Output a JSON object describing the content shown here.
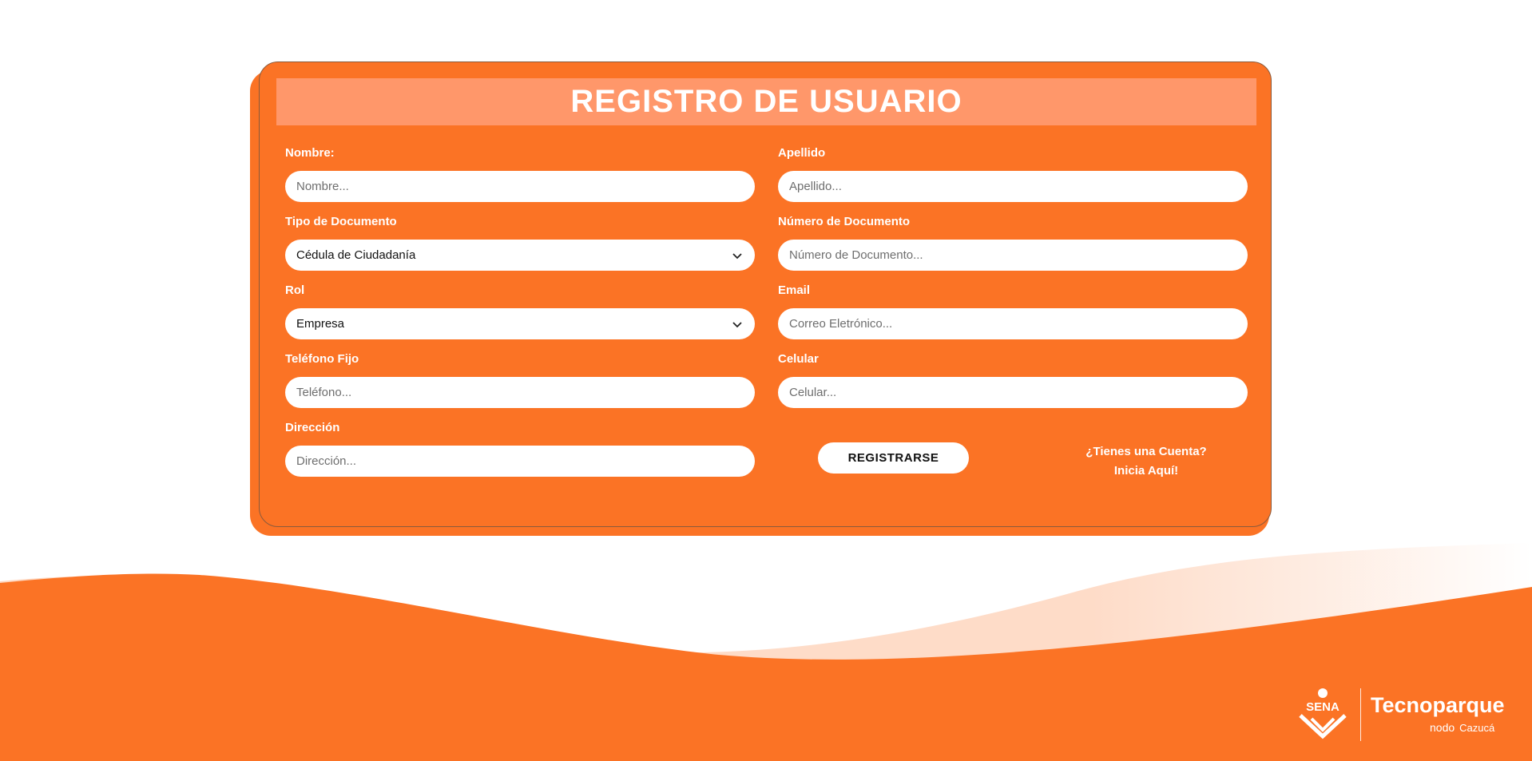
{
  "form": {
    "title": "REGISTRO DE USUARIO",
    "fields": {
      "nombre": {
        "label": "Nombre:",
        "placeholder": "Nombre..."
      },
      "apellido": {
        "label": "Apellido",
        "placeholder": "Apellido..."
      },
      "tipo_documento": {
        "label": "Tipo de Documento",
        "value": "Cédula de Ciudadanía"
      },
      "numero_documento": {
        "label": "Número de Documento",
        "placeholder": "Número de Documento..."
      },
      "rol": {
        "label": "Rol",
        "value": "Empresa"
      },
      "email": {
        "label": "Email",
        "placeholder": "Correo Eletrónico..."
      },
      "telefono": {
        "label": "Teléfono Fijo",
        "placeholder": "Teléfono..."
      },
      "celular": {
        "label": "Celular",
        "placeholder": "Celular..."
      },
      "direccion": {
        "label": "Dirección",
        "placeholder": "Dirección..."
      }
    },
    "register_button": "REGISTRARSE",
    "login_prompt_line1": "¿Tienes una Cuenta?",
    "login_prompt_line2": "Inicia Aquí!"
  },
  "footer": {
    "logo_text": "SENA",
    "brand": "Tecnoparque",
    "brand_sub": "nodo",
    "brand_location": "Cazucá"
  },
  "colors": {
    "primary": "#fb7325",
    "title_bar": "#ff976a",
    "white": "#ffffff"
  }
}
